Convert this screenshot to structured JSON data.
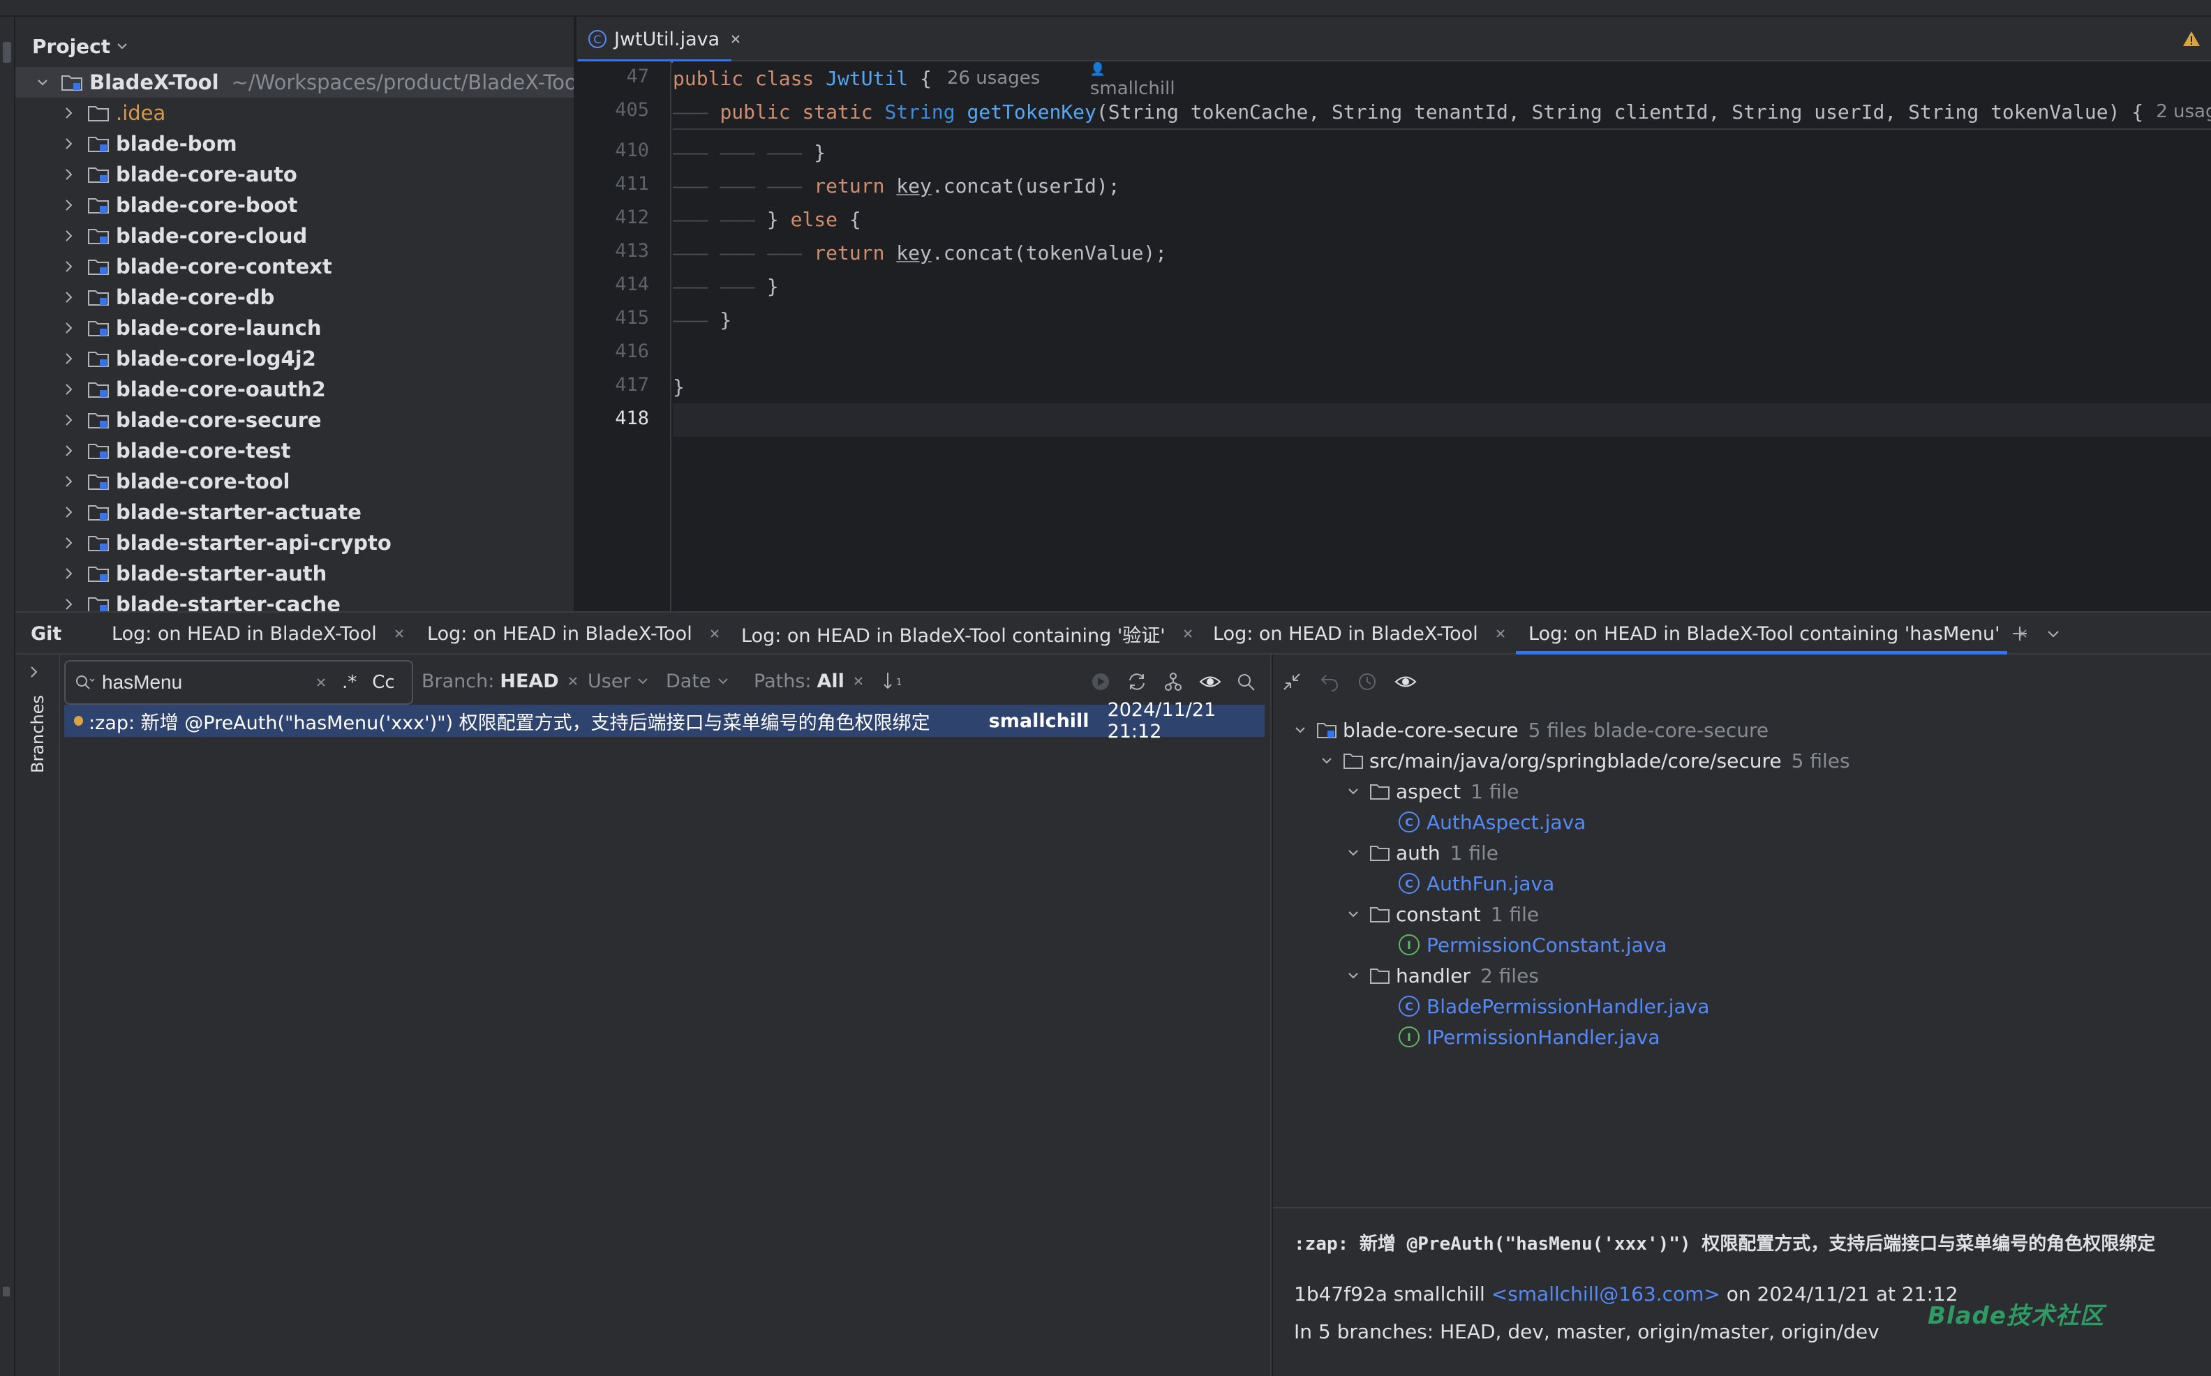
{
  "project_panel": {
    "title": "Project",
    "root": {
      "name": "BladeX-Tool",
      "path": "~/Workspaces/product/BladeX-Tool"
    },
    "items": [
      ".idea",
      "blade-bom",
      "blade-core-auto",
      "blade-core-boot",
      "blade-core-cloud",
      "blade-core-context",
      "blade-core-db",
      "blade-core-launch",
      "blade-core-log4j2",
      "blade-core-oauth2",
      "blade-core-secure",
      "blade-core-test",
      "blade-core-tool",
      "blade-starter-actuate",
      "blade-starter-api-crypto",
      "blade-starter-auth",
      "blade-starter-cache"
    ]
  },
  "editor": {
    "tab": "JwtUtil.java",
    "sticky": [
      {
        "line": "47",
        "keyword": "public class",
        "name": "JwtUtil",
        "brace": " {",
        "usages": "26 usages",
        "author": "smallchill"
      },
      {
        "line": "405",
        "mod": "public static",
        "type": "String",
        "method": "getTokenKey",
        "params": "(String tokenCache, String tenantId, String clientId, String userId, String tokenValue) {",
        "usages": "2 usag"
      }
    ],
    "lines": [
      {
        "n": "410",
        "guide": "——— ——— ———",
        "code": " }"
      },
      {
        "n": "411",
        "guide": "——— ——— ———",
        "kw": " return ",
        "var": "key",
        "code": ".concat(userId);"
      },
      {
        "n": "412",
        "guide": "——— ———",
        "code": " } ",
        "kw2": "else",
        "code2": " {"
      },
      {
        "n": "413",
        "guide": "——— ——— ———",
        "kw": " return ",
        "var": "key",
        "code": ".concat(tokenValue);"
      },
      {
        "n": "414",
        "guide": "——— ———",
        "code": " }"
      },
      {
        "n": "415",
        "guide": "———",
        "code": " }"
      },
      {
        "n": "416",
        "guide": "",
        "code": ""
      },
      {
        "n": "417",
        "guide": "",
        "code": "}"
      },
      {
        "n": "418",
        "guide": "",
        "code": ""
      }
    ]
  },
  "git": {
    "label": "Git",
    "tabs": [
      "Log: on HEAD in BladeX-Tool",
      "Log: on HEAD in BladeX-Tool",
      "Log: on HEAD in BladeX-Tool containing '验证'",
      "Log: on HEAD in BladeX-Tool",
      "Log: on HEAD in BladeX-Tool containing 'hasMenu'"
    ],
    "branches_label": "Branches",
    "search_value": "hasMenu",
    "regex_btn": ".*",
    "case_btn": "Cc",
    "filters": {
      "branch_label": "Branch:",
      "branch_value": "HEAD",
      "user": "User",
      "date": "Date",
      "paths_label": "Paths:",
      "paths_value": "All"
    },
    "commit": {
      "subject": ":zap: 新增 @PreAuth(\"hasMenu('xxx')\") 权限配置方式，支持后端接口与菜单编号的角色权限绑定",
      "author": "smallchill",
      "date": "2024/11/21 21:12"
    }
  },
  "changes": {
    "module": "blade-core-secure",
    "module_meta": "5 files  blade-core-secure",
    "path": "src/main/java/org/springblade/core/secure",
    "path_meta": "5 files",
    "folders": [
      {
        "name": "aspect",
        "meta": "1 file",
        "files": [
          {
            "name": "AuthAspect.java",
            "kind": "C"
          }
        ]
      },
      {
        "name": "auth",
        "meta": "1 file",
        "files": [
          {
            "name": "AuthFun.java",
            "kind": "C"
          }
        ]
      },
      {
        "name": "constant",
        "meta": "1 file",
        "files": [
          {
            "name": "PermissionConstant.java",
            "kind": "I"
          }
        ]
      },
      {
        "name": "handler",
        "meta": "2 files",
        "files": [
          {
            "name": "BladePermissionHandler.java",
            "kind": "C"
          },
          {
            "name": "IPermissionHandler.java",
            "kind": "I"
          }
        ]
      }
    ]
  },
  "details": {
    "subject": ":zap: 新增 @PreAuth(\"hasMenu('xxx')\") 权限配置方式，支持后端接口与菜单编号的角色权限绑定",
    "hash_author": "1b47f92a smallchill",
    "email": "<smallchill@163.com>",
    "on_date": "on 2024/11/21 at 21:12",
    "branches": "In 5 branches: HEAD, dev, master, origin/master, origin/dev",
    "watermark": "Blade技术社区"
  },
  "colors": {
    "accent": "#3574f0",
    "selection": "#2e436e",
    "keyword": "#cf8e6d",
    "function": "#56a8f5",
    "link": "#548af7"
  }
}
